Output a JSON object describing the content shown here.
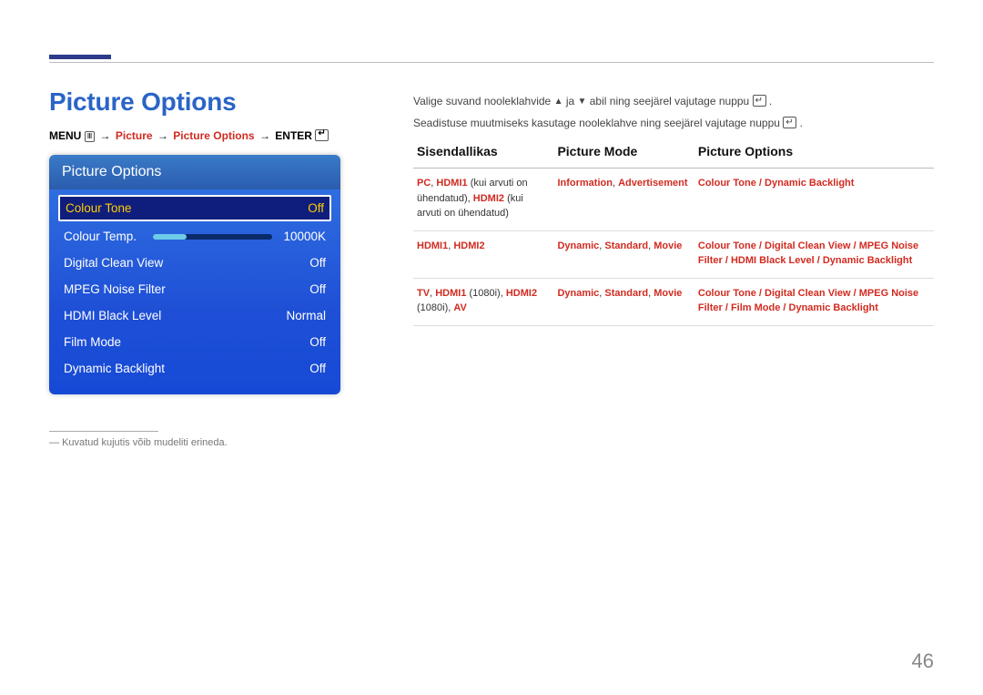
{
  "title": "Picture Options",
  "breadcrumb": {
    "menu": "MENU",
    "p1": "Picture",
    "p2": "Picture Options",
    "enter": "ENTER"
  },
  "osd": {
    "header": "Picture Options",
    "rows": [
      {
        "label": "Colour Tone",
        "value": "Off",
        "selected": true
      },
      {
        "label": "Colour Temp.",
        "value": "10000K",
        "slider": true
      },
      {
        "label": "Digital Clean View",
        "value": "Off"
      },
      {
        "label": "MPEG Noise Filter",
        "value": "Off"
      },
      {
        "label": "HDMI Black Level",
        "value": "Normal"
      },
      {
        "label": "Film Mode",
        "value": "Off"
      },
      {
        "label": "Dynamic Backlight",
        "value": "Off"
      }
    ]
  },
  "footnote": "Kuvatud kujutis võib mudeliti erineda.",
  "intro": {
    "l1a": "Valige suvand nooleklahvide ",
    "l1b": " ja ",
    "l1c": " abil ning seejärel vajutage nuppu ",
    "l1d": ".",
    "l2a": "Seadistuse muutmiseks kasutage nooleklahve ning seejärel vajutage nuppu ",
    "l2b": "."
  },
  "table": {
    "h1": "Sisendallikas",
    "h2": "Picture Mode",
    "h3": "Picture Options",
    "rows": [
      {
        "src_parts": [
          "PC",
          ", ",
          "HDMI1",
          " (kui arvuti on ühendatud), ",
          "HDMI2",
          " (kui arvuti on ühendatud)"
        ],
        "src_bold": [
          true,
          false,
          true,
          false,
          true,
          false
        ],
        "mode_parts": [
          "Information",
          ", ",
          "Advertisement"
        ],
        "mode_bold": [
          true,
          false,
          true
        ],
        "opt_parts": [
          "Colour Tone",
          " / ",
          "Dynamic Backlight"
        ],
        "opt_bold": [
          true,
          true,
          true
        ]
      },
      {
        "src_parts": [
          "HDMI1",
          ", ",
          "HDMI2"
        ],
        "src_bold": [
          true,
          false,
          true
        ],
        "mode_parts": [
          "Dynamic",
          ", ",
          "Standard",
          ", ",
          "Movie"
        ],
        "mode_bold": [
          true,
          false,
          true,
          false,
          true
        ],
        "opt_parts": [
          "Colour Tone",
          " / ",
          "Digital Clean View",
          " / ",
          "MPEG Noise Filter",
          " / ",
          "HDMI Black Level",
          " / ",
          "Dynamic Backlight"
        ],
        "opt_bold": [
          true,
          true,
          true,
          true,
          true,
          true,
          true,
          true,
          true
        ]
      },
      {
        "src_parts": [
          "TV",
          ", ",
          "HDMI1",
          " (1080i), ",
          "HDMI2",
          " (1080i), ",
          "AV"
        ],
        "src_bold": [
          true,
          false,
          true,
          false,
          true,
          false,
          true
        ],
        "mode_parts": [
          "Dynamic",
          ", ",
          "Standard",
          ", ",
          "Movie"
        ],
        "mode_bold": [
          true,
          false,
          true,
          false,
          true
        ],
        "opt_parts": [
          "Colour Tone",
          " / ",
          "Digital Clean View",
          " / ",
          "MPEG Noise Filter",
          " / ",
          "Film Mode",
          " / ",
          "Dynamic Backlight"
        ],
        "opt_bold": [
          true,
          true,
          true,
          true,
          true,
          true,
          true,
          true,
          true
        ]
      }
    ]
  },
  "page": "46"
}
